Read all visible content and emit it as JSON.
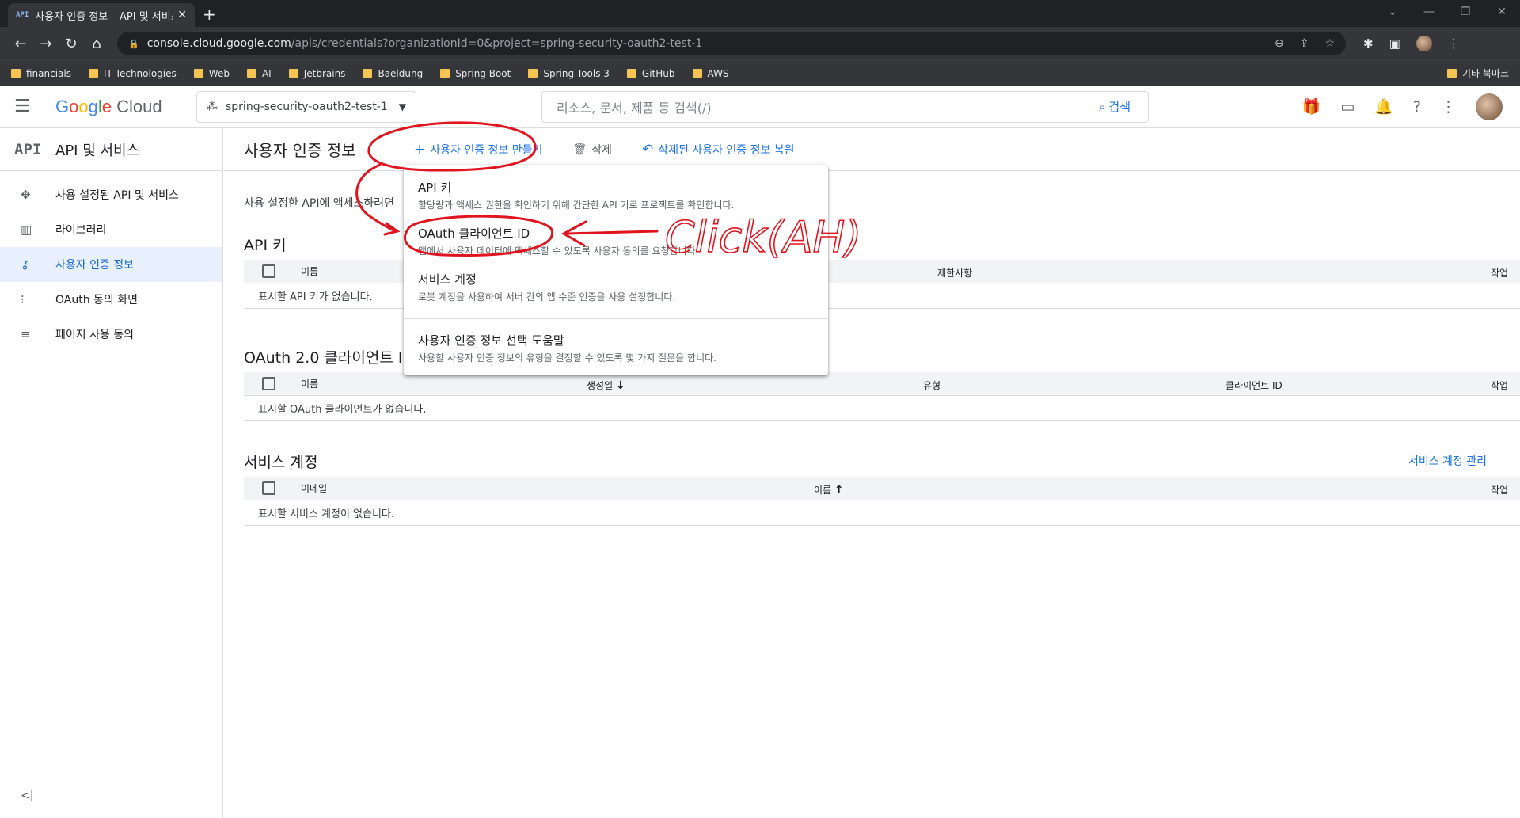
{
  "browser": {
    "tab_favicon": "API",
    "tab_title": "사용자 인증 정보 – API 및 서비스",
    "url_host": "console.cloud.google.com",
    "url_path": "/apis/credentials?organizationId=0&project=spring-security-oauth2-test-1",
    "bookmarks": [
      "financials",
      "IT Technologies",
      "Web",
      "AI",
      "Jetbrains",
      "Baeldung",
      "Spring Boot",
      "Spring Tools 3",
      "GitHub",
      "AWS"
    ],
    "bookmarks_right": "기타 북마크"
  },
  "header": {
    "logo_word": "Google",
    "logo_cloud": "Cloud",
    "project": "spring-security-oauth2-test-1",
    "search_placeholder": "리소스, 문서, 제품 등 검색(/)",
    "search_button": "검색"
  },
  "sidebar": {
    "mark": "API",
    "title": "API 및 서비스",
    "items": [
      {
        "label": "사용 설정된 API 및 서비스",
        "icon": "enabled-apis-icon"
      },
      {
        "label": "라이브러리",
        "icon": "library-icon"
      },
      {
        "label": "사용자 인증 정보",
        "icon": "key-icon"
      },
      {
        "label": "OAuth 동의 화면",
        "icon": "consent-icon"
      },
      {
        "label": "페이지 사용 동의",
        "icon": "page-consent-icon"
      }
    ],
    "collapse": "<|"
  },
  "main": {
    "title": "사용자 인증 정보",
    "create_label": "사용자 인증 정보 만들기",
    "delete_label": "삭제",
    "restore_label": "삭제된 사용자 인증 정보 복원",
    "intro": "사용 설정한 API에 액세스하려면",
    "api_keys": {
      "title": "API 키",
      "col_name": "이름",
      "col_restrictions": "제한사항",
      "col_actions": "작업",
      "empty": "표시할 API 키가 없습니다."
    },
    "oauth": {
      "title": "OAuth 2.0 클라이언트 I",
      "col_name": "이름",
      "col_created": "생성일",
      "col_type": "유형",
      "col_client_id": "클라이언트 ID",
      "col_actions": "작업",
      "empty": "표시할 OAuth 클라이언트가 없습니다."
    },
    "service_accounts": {
      "title": "서비스 계정",
      "manage": "서비스 계정 관리",
      "col_email": "이메일",
      "col_name": "이름",
      "col_actions": "작업",
      "empty": "표시할 서비스 계정이 없습니다."
    }
  },
  "menu": {
    "items": [
      {
        "title": "API 키",
        "desc": "할당량과 액세스 권한을 확인하기 위해 간단한 API 키로 프로젝트를 확인합니다."
      },
      {
        "title": "OAuth 클라이언트 ID",
        "desc": "앱에서 사용자 데이터에 액세스할 수 있도록 사용자 동의를 요청합니다."
      },
      {
        "title": "서비스 계정",
        "desc": "로봇 계정을 사용하여 서버 간의 앱 수준 인증을 사용 설정합니다."
      },
      {
        "title": "사용자 인증 정보 선택 도움말",
        "desc": "사용할 사용자 인증 정보의 유형을 결정할 수 있도록 몇 가지 질문을 합니다."
      }
    ]
  },
  "annotation": {
    "text": "Click(AH)",
    "color": "#e0141e"
  }
}
